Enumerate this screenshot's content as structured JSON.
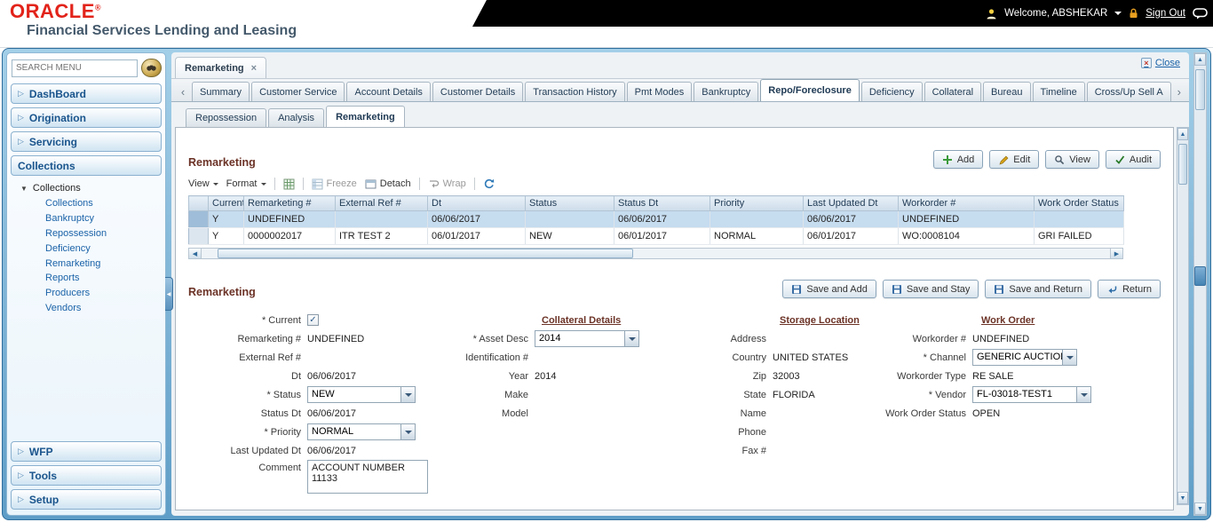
{
  "colors": {
    "brand_red": "#e2231a",
    "accent_blue": "#19548c",
    "link_blue": "#1a62a8",
    "section_title": "#6b3226",
    "selected_row": "#c6dcef",
    "frame_blue": "#2e6e9e"
  },
  "icons": {
    "user": "user-icon",
    "lock": "lock-icon",
    "chat": "chat-icon",
    "search": "binoculars-icon",
    "add": "plus-icon",
    "edit": "pencil-icon",
    "view": "magnifier-icon",
    "audit": "check-icon",
    "save": "floppy-icon",
    "return": "return-arrow-icon",
    "refresh": "refresh-icon",
    "export": "spreadsheet-icon",
    "freeze": "freeze-icon",
    "detach": "detach-icon",
    "wrap": "wrap-icon"
  },
  "header": {
    "logo": "ORACLE",
    "logo_mark": "®",
    "product": "Financial Services Lending and Leasing",
    "welcome": "Welcome, ABSHEKAR",
    "sign_out": "Sign Out"
  },
  "sidebar": {
    "search": {
      "placeholder": "SEARCH MENU"
    },
    "accordion_top": [
      "DashBoard",
      "Origination",
      "Servicing",
      "Collections"
    ],
    "tree": {
      "root": "Collections",
      "items": [
        "Collections",
        "Bankruptcy",
        "Repossession",
        "Deficiency",
        "Remarketing",
        "Reports",
        "Producers",
        "Vendors"
      ]
    },
    "accordion_bottom": [
      "WFP",
      "Tools",
      "Setup"
    ]
  },
  "window": {
    "doc_tab": "Remarketing",
    "close": "Close"
  },
  "tabstrip": {
    "tabs": [
      "Summary",
      "Customer Service",
      "Account Details",
      "Customer Details",
      "Transaction History",
      "Pmt Modes",
      "Bankruptcy",
      "Repo/Foreclosure",
      "Deficiency",
      "Collateral",
      "Bureau",
      "Timeline",
      "Cross/Up Sell A"
    ],
    "active": "Repo/Foreclosure",
    "active_index": 7
  },
  "subtabs": {
    "tabs": [
      "Repossession",
      "Analysis",
      "Remarketing"
    ],
    "active": "Remarketing"
  },
  "grid": {
    "title": "Remarketing",
    "actions": [
      {
        "label": "Add"
      },
      {
        "label": "Edit"
      },
      {
        "label": "View"
      },
      {
        "label": "Audit"
      }
    ],
    "toolbar": {
      "view": "View",
      "format": "Format",
      "freeze": "Freeze",
      "detach": "Detach",
      "wrap": "Wrap"
    },
    "columns": [
      "Current",
      "Remarketing #",
      "External Ref #",
      "Dt",
      "Status",
      "Status Dt",
      "Priority",
      "Last Updated Dt",
      "Workorder #",
      "Work Order Status"
    ],
    "rows": [
      [
        "Y",
        "UNDEFINED",
        "",
        "06/06/2017",
        "",
        "06/06/2017",
        "",
        "06/06/2017",
        "UNDEFINED",
        ""
      ],
      [
        "Y",
        "0000002017",
        "ITR TEST 2",
        "06/01/2017",
        "NEW",
        "06/01/2017",
        "NORMAL",
        "06/01/2017",
        "WO:0008104",
        "GRI FAILED"
      ]
    ]
  },
  "form": {
    "title": "Remarketing",
    "buttons": [
      "Save and Add",
      "Save and Stay",
      "Save and Return",
      "Return"
    ],
    "fields": {
      "current": {
        "label": "* Current",
        "checked": true
      },
      "remarketing_no": {
        "label": "Remarketing #",
        "value": "UNDEFINED"
      },
      "external_ref": {
        "label": "External Ref #",
        "value": ""
      },
      "dt": {
        "label": "Dt",
        "value": "06/06/2017"
      },
      "status": {
        "label": "* Status",
        "value": "NEW"
      },
      "status_dt": {
        "label": "Status Dt",
        "value": "06/06/2017"
      },
      "priority": {
        "label": "* Priority",
        "value": "NORMAL"
      },
      "last_updated_dt": {
        "label": "Last Updated Dt",
        "value": "06/06/2017"
      },
      "comment": {
        "label": "Comment",
        "value": "ACCOUNT NUMBER 11133"
      }
    },
    "collateral": {
      "title": "Collateral Details",
      "asset_desc": {
        "label": "* Asset Desc",
        "value": "2014"
      },
      "identification": {
        "label": "Identification #",
        "value": ""
      },
      "year": {
        "label": "Year",
        "value": "2014"
      },
      "make": {
        "label": "Make",
        "value": ""
      },
      "model": {
        "label": "Model",
        "value": ""
      }
    },
    "storage": {
      "title": "Storage Location",
      "address": {
        "label": "Address",
        "value": ""
      },
      "country": {
        "label": "Country",
        "value": "UNITED STATES"
      },
      "zip": {
        "label": "Zip",
        "value": "32003"
      },
      "state": {
        "label": "State",
        "value": "FLORIDA"
      },
      "name": {
        "label": "Name",
        "value": ""
      },
      "phone": {
        "label": "Phone",
        "value": ""
      },
      "fax": {
        "label": "Fax #",
        "value": ""
      }
    },
    "work_order": {
      "title": "Work Order",
      "workorder_no": {
        "label": "Workorder #",
        "value": "UNDEFINED"
      },
      "channel": {
        "label": "* Channel",
        "value": "GENERIC AUCTION INT"
      },
      "workorder_type": {
        "label": "Workorder Type",
        "value": "RE SALE"
      },
      "vendor": {
        "label": "* Vendor",
        "value": "FL-03018-TEST1"
      },
      "wo_status": {
        "label": "Work Order Status",
        "value": "OPEN"
      }
    }
  }
}
